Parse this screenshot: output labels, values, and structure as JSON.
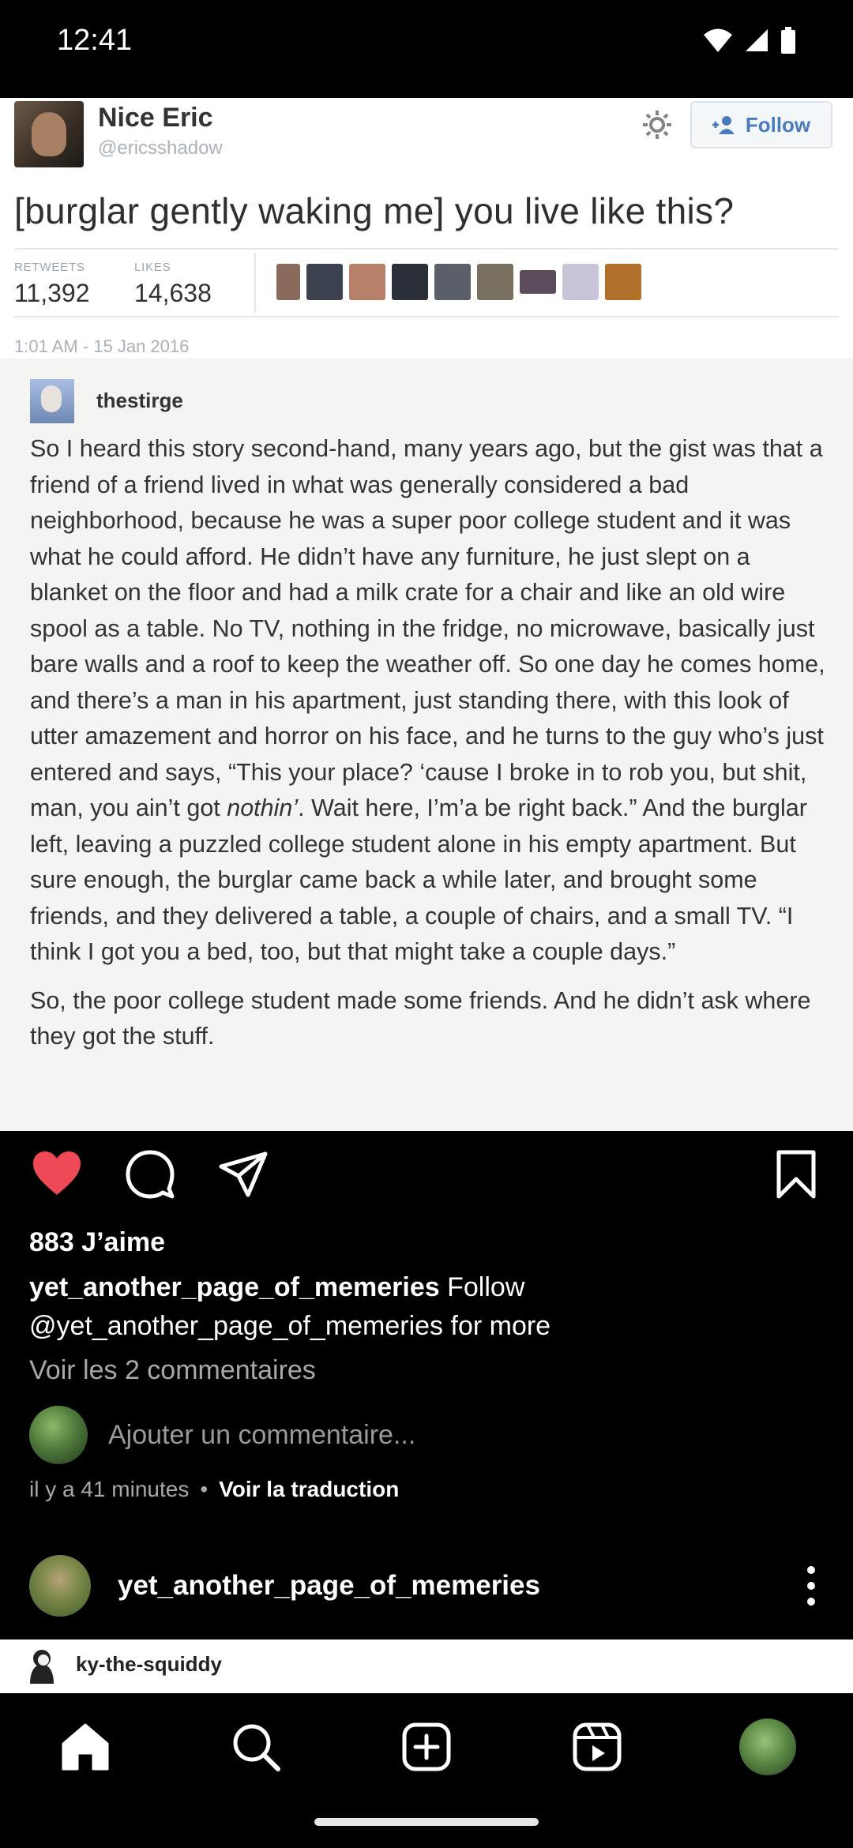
{
  "status_bar": {
    "time": "12:41"
  },
  "post_image": {
    "tweet": {
      "name": "Nice Eric",
      "handle": "@ericsshadow",
      "follow_label": "Follow",
      "text": "[burglar gently waking me] you live like this?",
      "retweets_label": "RETWEETS",
      "retweets_value": "11,392",
      "likes_label": "LIKES",
      "likes_value": "14,638",
      "date": "1:01 AM - 15 Jan 2016"
    },
    "tumblr": {
      "username": "thestirge",
      "paragraph1_part1": "So I heard this story second-hand, many years ago, but the gist was that a friend of a friend lived in what was generally considered a bad neighborhood, because he was a super poor college student and it was what he could afford. He didn’t have any furniture, he just slept on a blanket on the floor and had a milk crate for a chair and like an old wire spool as a table. No TV, nothing in the fridge, no microwave, basically just bare walls and a roof to keep the weather off. So one day he comes home, and there’s a man in his apartment, just standing there, with this look of utter amazement and horror on his face, and he turns to the guy who’s just entered and says, “This your place? ‘cause I broke in to rob you, but shit, man, you ain’t got ",
      "paragraph1_emph": "nothin’",
      "paragraph1_part2": ". Wait here, I’m’a be right back.” And the burglar left, leaving a puzzled college student alone in his empty apartment. But sure enough, the burglar came back a while later, and brought some friends, and they delivered a table, a couple of chairs, and a small TV. “I think I got you a bed, too, but that might take a couple days.”",
      "paragraph2": "So, the poor college student made some friends. And he didn’t ask where they got the stuff."
    }
  },
  "post": {
    "likes": "883 J’aime",
    "caption_user": "yet_another_page_of_memeries",
    "caption_text": " Follow @yet_another_page_of_memeries for more",
    "view_comments": "Voir les 2 commentaires",
    "comment_placeholder": "Ajouter un commentaire...",
    "time_ago": "il y a 41 minutes",
    "separator": "•",
    "translate": "Voir la traduction"
  },
  "next_post": {
    "username": "yet_another_page_of_memeries",
    "strip_username": "ky-the-squiddy"
  },
  "colors": {
    "like_red": "#ed4956",
    "link_blue": "#4a7bbf"
  }
}
